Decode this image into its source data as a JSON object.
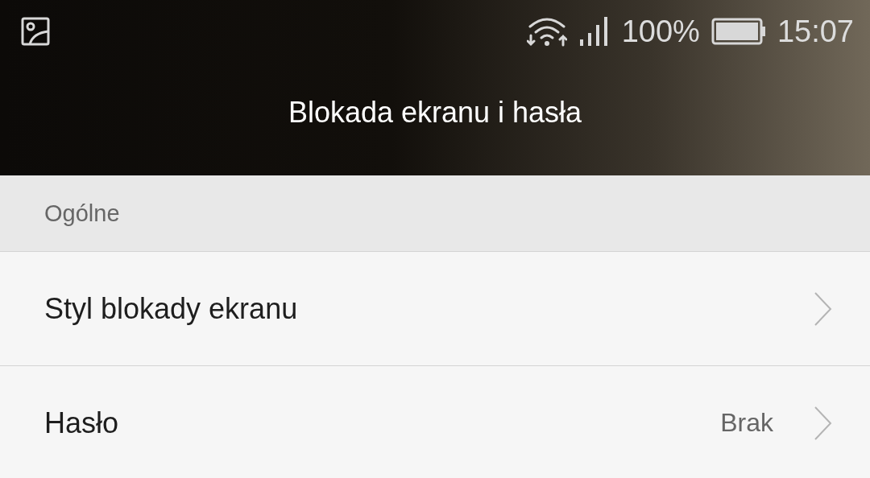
{
  "status_bar": {
    "battery": "100%",
    "time": "15:07"
  },
  "header": {
    "title": "Blokada ekranu i hasła"
  },
  "section": {
    "title": "Ogólne"
  },
  "items": [
    {
      "label": "Styl blokady ekranu"
    },
    {
      "label": "Hasło",
      "value": "Brak"
    }
  ]
}
